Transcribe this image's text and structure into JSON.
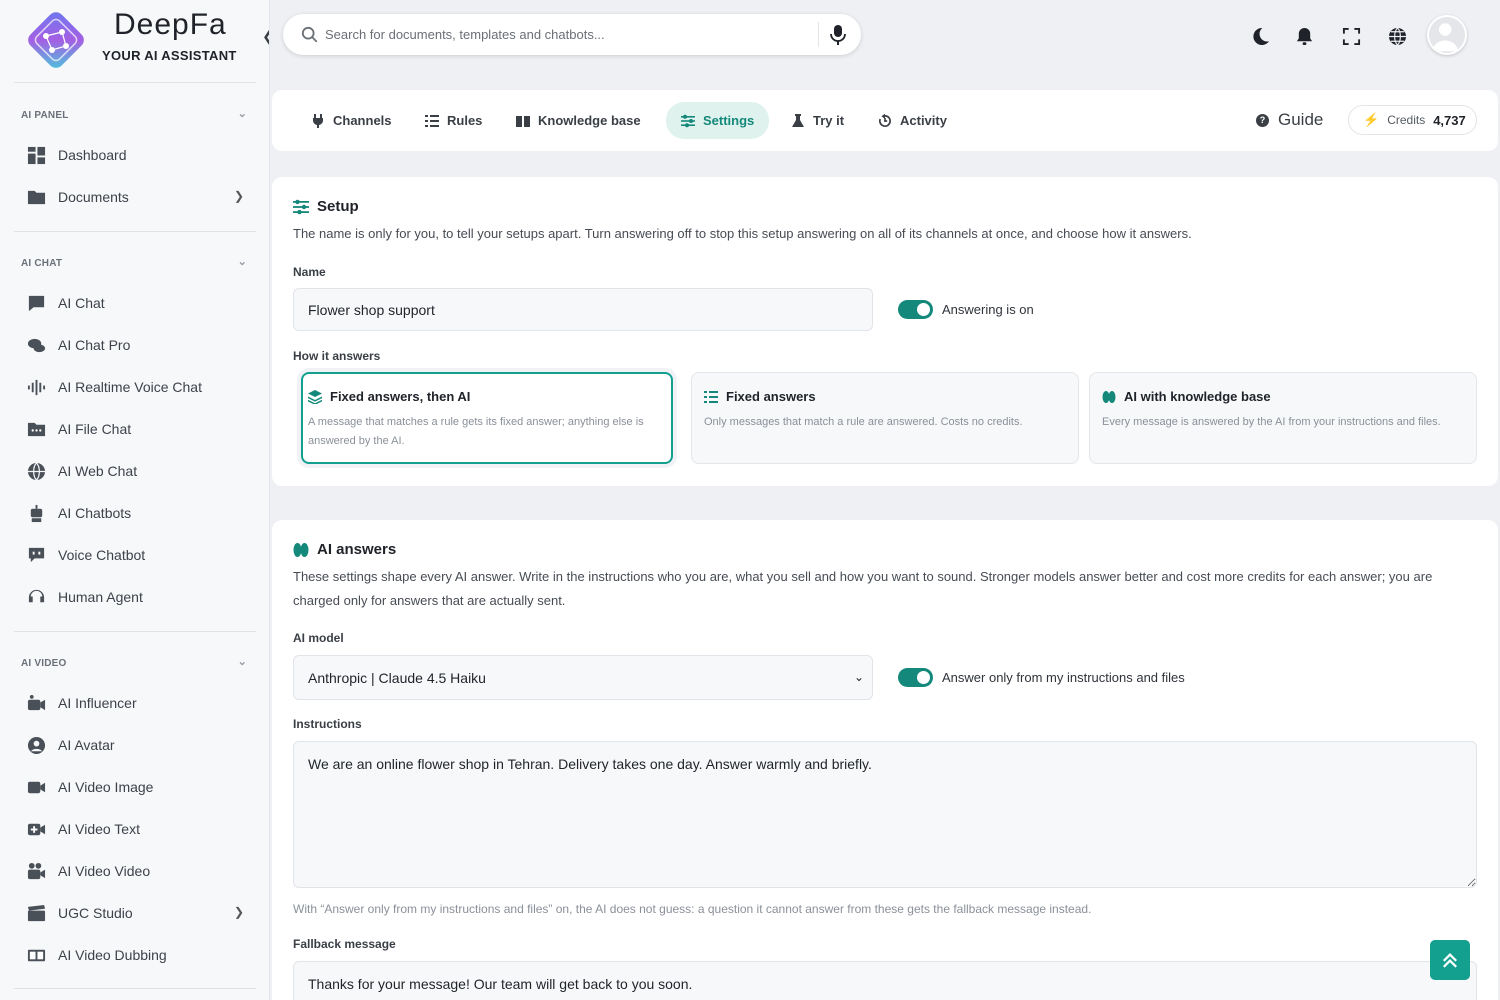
{
  "brand": {
    "name": "DeepFa",
    "tagline": "YOUR AI ASSISTANT"
  },
  "sidebar": {
    "sections": [
      {
        "title": "AI PANEL",
        "items": [
          {
            "label": "Dashboard",
            "icon": "dashboard-icon",
            "has_submenu": false
          },
          {
            "label": "Documents",
            "icon": "folder-icon",
            "has_submenu": true
          }
        ]
      },
      {
        "title": "AI CHAT",
        "items": [
          {
            "label": "AI Chat",
            "icon": "chat-icon",
            "has_submenu": false
          },
          {
            "label": "AI Chat Pro",
            "icon": "chats-icon",
            "has_submenu": false
          },
          {
            "label": "AI Realtime Voice Chat",
            "icon": "waveform-icon",
            "has_submenu": false
          },
          {
            "label": "AI File Chat",
            "icon": "file-folder-icon",
            "has_submenu": false
          },
          {
            "label": "AI Web Chat",
            "icon": "globe-icon",
            "has_submenu": false
          },
          {
            "label": "AI Chatbots",
            "icon": "robot-icon",
            "has_submenu": false
          },
          {
            "label": "Voice Chatbot",
            "icon": "voice-bot-icon",
            "has_submenu": false
          },
          {
            "label": "Human Agent",
            "icon": "headset-icon",
            "has_submenu": false
          }
        ]
      },
      {
        "title": "AI VIDEO",
        "items": [
          {
            "label": "AI Influencer",
            "icon": "influencer-icon",
            "has_submenu": false
          },
          {
            "label": "AI Avatar",
            "icon": "avatar-icon",
            "has_submenu": false
          },
          {
            "label": "AI Video Image",
            "icon": "video-camera-icon",
            "has_submenu": false
          },
          {
            "label": "AI Video Text",
            "icon": "video-plus-icon",
            "has_submenu": false
          },
          {
            "label": "AI Video Video",
            "icon": "film-camera-icon",
            "has_submenu": false
          },
          {
            "label": "UGC Studio",
            "icon": "clapper-icon",
            "has_submenu": true
          },
          {
            "label": "AI Video Dubbing",
            "icon": "dubbing-icon",
            "has_submenu": false
          }
        ]
      }
    ]
  },
  "search": {
    "placeholder": "Search for documents, templates and chatbots..."
  },
  "tabs": [
    {
      "label": "Channels",
      "icon": "plug-icon",
      "active": false
    },
    {
      "label": "Rules",
      "icon": "list-check-icon",
      "active": false
    },
    {
      "label": "Knowledge base",
      "icon": "book-icon",
      "active": false
    },
    {
      "label": "Settings",
      "icon": "sliders-icon",
      "active": true
    },
    {
      "label": "Try it",
      "icon": "flask-icon",
      "active": false
    },
    {
      "label": "Activity",
      "icon": "history-icon",
      "active": false
    }
  ],
  "guide_label": "Guide",
  "credits": {
    "label": "Credits",
    "value": "4,737"
  },
  "setup": {
    "title": "Setup",
    "description": "The name is only for you, to tell your setups apart. Turn answering off to stop this setup answering on all of its channels at once, and choose how it answers.",
    "name_label": "Name",
    "name_value": "Flower shop support",
    "answering_toggle_label": "Answering is on",
    "answering_on": true,
    "how_label": "How it answers",
    "modes": [
      {
        "title": "Fixed answers, then AI",
        "description": "A message that matches a rule gets its fixed answer; anything else is answered by the AI.",
        "selected": true
      },
      {
        "title": "Fixed answers",
        "description": "Only messages that match a rule are answered. Costs no credits.",
        "selected": false
      },
      {
        "title": "AI with knowledge base",
        "description": "Every message is answered by the AI from your instructions and files.",
        "selected": false
      }
    ]
  },
  "ai_answers": {
    "title": "AI answers",
    "description": "These settings shape every AI answer. Write in the instructions who you are, what you sell and how you want to sound. Stronger models answer better and cost more credits for each answer; you are charged only for answers that are actually sent.",
    "model_label": "AI model",
    "model_value": "Anthropic | Claude 4.5 Haiku",
    "only_files_toggle_label": "Answer only from my instructions and files",
    "only_files_on": true,
    "instructions_label": "Instructions",
    "instructions_value": "We are an online flower shop in Tehran. Delivery takes one day. Answer warmly and briefly.",
    "hint": "With “Answer only from my instructions and files” on, the AI does not guess: a question it cannot answer from these gets the fallback message instead.",
    "fallback_label": "Fallback message",
    "fallback_value": "Thanks for your message! Our team will get back to you soon."
  },
  "colors": {
    "accent": "#14887a",
    "accent_bright": "#14a08f",
    "accent_soft": "#dff2ee"
  }
}
